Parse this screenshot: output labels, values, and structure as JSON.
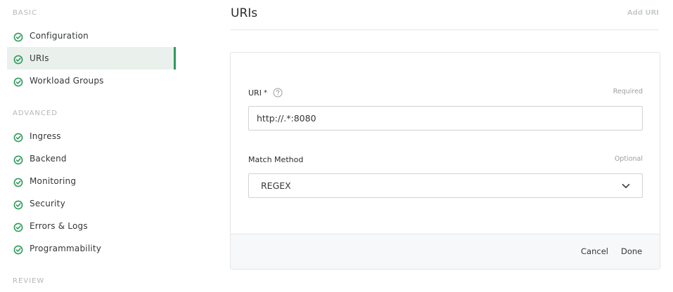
{
  "sidebar": {
    "sections": {
      "basic": "BASIC",
      "advanced": "ADVANCED",
      "review": "REVIEW"
    },
    "items": [
      {
        "label": "Configuration",
        "icon": "check-circle-icon",
        "active": false
      },
      {
        "label": "URIs",
        "icon": "check-circle-icon",
        "active": true
      },
      {
        "label": "Workload Groups",
        "icon": "check-circle-icon",
        "active": false
      },
      {
        "label": "Ingress",
        "icon": "check-circle-icon",
        "active": false
      },
      {
        "label": "Backend",
        "icon": "check-circle-icon",
        "active": false
      },
      {
        "label": "Monitoring",
        "icon": "check-circle-icon",
        "active": false
      },
      {
        "label": "Security",
        "icon": "check-circle-icon",
        "active": false
      },
      {
        "label": "Errors & Logs",
        "icon": "check-circle-icon",
        "active": false
      },
      {
        "label": "Programmability",
        "icon": "check-circle-icon",
        "active": false
      }
    ]
  },
  "main": {
    "title": "URIs",
    "add_label": "Add URI"
  },
  "form": {
    "uri": {
      "label": "URI",
      "asterisk": "*",
      "tag": "Required",
      "value": "http://.*:8080"
    },
    "match_method": {
      "label": "Match Method",
      "tag": "Optional",
      "value": "REGEX"
    },
    "cancel_label": "Cancel",
    "done_label": "Done"
  },
  "colors": {
    "accent": "#2f9a5c",
    "active_bg": "#eaf1ec"
  }
}
